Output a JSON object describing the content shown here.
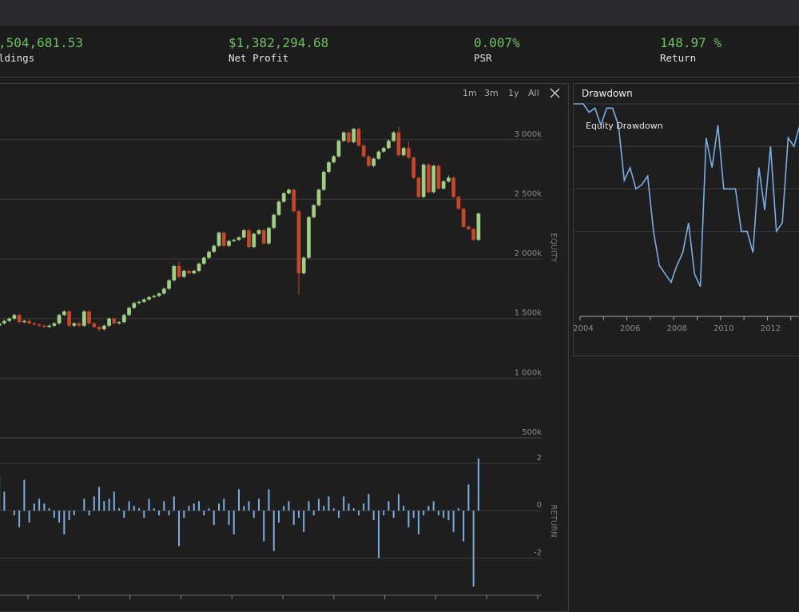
{
  "stats": [
    {
      "value": ",504,681.53",
      "label": "ldings"
    },
    {
      "value": "$1,382,294.68",
      "label": "Net Profit"
    },
    {
      "value": "0.007%",
      "label": "PSR"
    },
    {
      "value": "148.97 %",
      "label": "Return"
    }
  ],
  "range_buttons": [
    "1m",
    "3m",
    "1y",
    "All"
  ],
  "colors": {
    "up": "#9fcf80",
    "down": "#c8452a",
    "return_bar": "#7aaee0",
    "drawdown_line": "#7aaee0",
    "stat_value": "#6cc160"
  },
  "icons": {
    "close": "close-icon"
  },
  "equity_axis": {
    "label": "EQUITY",
    "ticks": [
      "500k",
      "1 000k",
      "1 500k",
      "2 000k",
      "2 500k",
      "3 000k"
    ]
  },
  "return_axis": {
    "label": "RETURN",
    "ticks": [
      "2",
      "0",
      "-2"
    ]
  },
  "drawdown": {
    "title": "Drawdown",
    "legend": "Equity Drawdown",
    "x_ticks": [
      "2004",
      "2006",
      "2008",
      "2010",
      "2012"
    ]
  },
  "chart_data": [
    {
      "type": "candlestick",
      "ylabel": "EQUITY",
      "ylim": [
        500000,
        3300000
      ],
      "candles": [
        [
          1440000,
          1460000,
          1420000,
          1470000
        ],
        [
          1460000,
          1480000,
          1450000,
          1490000
        ],
        [
          1480000,
          1500000,
          1470000,
          1510000
        ],
        [
          1500000,
          1530000,
          1490000,
          1540000
        ],
        [
          1530000,
          1470000,
          1460000,
          1540000
        ],
        [
          1470000,
          1480000,
          1460000,
          1490000
        ],
        [
          1480000,
          1460000,
          1450000,
          1490000
        ],
        [
          1460000,
          1450000,
          1440000,
          1470000
        ],
        [
          1450000,
          1440000,
          1430000,
          1460000
        ],
        [
          1440000,
          1430000,
          1420000,
          1450000
        ],
        [
          1430000,
          1440000,
          1420000,
          1450000
        ],
        [
          1440000,
          1460000,
          1430000,
          1470000
        ],
        [
          1460000,
          1530000,
          1450000,
          1540000
        ],
        [
          1530000,
          1560000,
          1520000,
          1570000
        ],
        [
          1560000,
          1440000,
          1430000,
          1570000
        ],
        [
          1440000,
          1460000,
          1430000,
          1470000
        ],
        [
          1460000,
          1440000,
          1430000,
          1470000
        ],
        [
          1440000,
          1560000,
          1430000,
          1570000
        ],
        [
          1560000,
          1460000,
          1450000,
          1570000
        ],
        [
          1460000,
          1430000,
          1420000,
          1470000
        ],
        [
          1430000,
          1410000,
          1390000,
          1440000
        ],
        [
          1410000,
          1440000,
          1400000,
          1450000
        ],
        [
          1440000,
          1500000,
          1430000,
          1510000
        ],
        [
          1500000,
          1460000,
          1450000,
          1510000
        ],
        [
          1460000,
          1470000,
          1450000,
          1480000
        ],
        [
          1470000,
          1530000,
          1460000,
          1540000
        ],
        [
          1530000,
          1590000,
          1520000,
          1600000
        ],
        [
          1590000,
          1630000,
          1580000,
          1640000
        ],
        [
          1630000,
          1640000,
          1620000,
          1650000
        ],
        [
          1640000,
          1660000,
          1630000,
          1670000
        ],
        [
          1660000,
          1680000,
          1650000,
          1690000
        ],
        [
          1680000,
          1690000,
          1670000,
          1700000
        ],
        [
          1690000,
          1710000,
          1680000,
          1720000
        ],
        [
          1710000,
          1750000,
          1700000,
          1760000
        ],
        [
          1750000,
          1820000,
          1740000,
          1830000
        ],
        [
          1820000,
          1940000,
          1810000,
          1950000
        ],
        [
          1940000,
          1850000,
          1840000,
          1980000
        ],
        [
          1850000,
          1900000,
          1840000,
          1910000
        ],
        [
          1900000,
          1880000,
          1870000,
          1910000
        ],
        [
          1880000,
          1900000,
          1870000,
          1910000
        ],
        [
          1900000,
          1960000,
          1890000,
          1970000
        ],
        [
          1960000,
          2010000,
          1950000,
          2020000
        ],
        [
          2010000,
          2060000,
          2000000,
          2070000
        ],
        [
          2060000,
          2110000,
          2050000,
          2120000
        ],
        [
          2110000,
          2220000,
          2100000,
          2230000
        ],
        [
          2220000,
          2110000,
          2100000,
          2230000
        ],
        [
          2110000,
          2150000,
          2100000,
          2160000
        ],
        [
          2150000,
          2160000,
          2140000,
          2170000
        ],
        [
          2160000,
          2180000,
          2150000,
          2190000
        ],
        [
          2180000,
          2240000,
          2170000,
          2250000
        ],
        [
          2240000,
          2100000,
          2090000,
          2250000
        ],
        [
          2100000,
          2210000,
          2090000,
          2220000
        ],
        [
          2210000,
          2240000,
          2200000,
          2250000
        ],
        [
          2240000,
          2130000,
          2120000,
          2250000
        ],
        [
          2130000,
          2260000,
          2120000,
          2270000
        ],
        [
          2260000,
          2370000,
          2250000,
          2380000
        ],
        [
          2370000,
          2480000,
          2360000,
          2490000
        ],
        [
          2480000,
          2550000,
          2470000,
          2560000
        ],
        [
          2550000,
          2580000,
          2540000,
          2590000
        ],
        [
          2580000,
          2400000,
          2390000,
          2590000
        ],
        [
          2400000,
          1880000,
          1700000,
          2410000
        ],
        [
          1880000,
          2010000,
          1870000,
          2020000
        ],
        [
          2010000,
          2350000,
          2000000,
          2360000
        ],
        [
          2350000,
          2450000,
          2340000,
          2460000
        ],
        [
          2450000,
          2580000,
          2440000,
          2590000
        ],
        [
          2580000,
          2730000,
          2570000,
          2740000
        ],
        [
          2730000,
          2810000,
          2720000,
          2820000
        ],
        [
          2810000,
          2860000,
          2800000,
          2870000
        ],
        [
          2860000,
          2990000,
          2850000,
          3000000
        ],
        [
          2990000,
          3060000,
          2980000,
          3070000
        ],
        [
          3060000,
          2980000,
          2970000,
          3070000
        ],
        [
          2980000,
          3090000,
          2970000,
          3100000
        ],
        [
          3090000,
          2950000,
          2940000,
          3100000
        ],
        [
          2950000,
          2860000,
          2850000,
          2960000
        ],
        [
          2860000,
          2780000,
          2770000,
          2870000
        ],
        [
          2780000,
          2840000,
          2770000,
          2850000
        ],
        [
          2840000,
          2900000,
          2830000,
          2910000
        ],
        [
          2900000,
          2930000,
          2890000,
          2940000
        ],
        [
          2930000,
          2990000,
          2920000,
          3000000
        ],
        [
          2990000,
          3060000,
          2980000,
          3070000
        ],
        [
          3060000,
          2870000,
          2860000,
          3110000
        ],
        [
          2870000,
          2930000,
          2860000,
          2940000
        ],
        [
          2930000,
          2850000,
          2840000,
          2980000
        ],
        [
          2850000,
          2680000,
          2670000,
          2860000
        ],
        [
          2680000,
          2520000,
          2510000,
          2690000
        ],
        [
          2520000,
          2790000,
          2510000,
          2800000
        ],
        [
          2790000,
          2560000,
          2550000,
          2800000
        ],
        [
          2560000,
          2780000,
          2550000,
          2790000
        ],
        [
          2780000,
          2590000,
          2580000,
          2790000
        ],
        [
          2590000,
          2650000,
          2580000,
          2660000
        ],
        [
          2650000,
          2680000,
          2640000,
          2700000
        ],
        [
          2680000,
          2520000,
          2510000,
          2690000
        ],
        [
          2520000,
          2420000,
          2410000,
          2530000
        ],
        [
          2420000,
          2270000,
          2260000,
          2430000
        ],
        [
          2270000,
          2250000,
          2240000,
          2280000
        ],
        [
          2250000,
          2160000,
          2150000,
          2260000
        ],
        [
          2160000,
          2380000,
          2150000,
          2390000
        ]
      ]
    },
    {
      "type": "bar",
      "ylabel": "RETURN",
      "ylim": [
        -3.4,
        2.6
      ],
      "values": [
        1.5,
        0.8,
        0,
        -0.2,
        -0.7,
        1.3,
        -0.5,
        0.3,
        0.5,
        0.3,
        0.1,
        -0.3,
        -0.5,
        -1.0,
        -0.4,
        -0.2,
        0,
        0.5,
        -0.2,
        0.6,
        1.0,
        0.4,
        0.5,
        0.8,
        0.1,
        -0.3,
        0.4,
        0.2,
        0.1,
        -0.3,
        0.5,
        0.1,
        -0.2,
        0.4,
        -0.2,
        0.6,
        -1.5,
        -0.3,
        0.2,
        0.3,
        0.4,
        -0.2,
        0.1,
        -0.6,
        0.3,
        0.5,
        -0.6,
        -1.0,
        0.9,
        0.2,
        0.4,
        -0.3,
        0.5,
        -1.3,
        0.9,
        -1.7,
        -0.5,
        0.2,
        0.4,
        -0.6,
        -0.3,
        -0.9,
        0.4,
        -0.2,
        0.5,
        0.2,
        0.6,
        0.1,
        -0.3,
        0.6,
        0.3,
        0.1,
        -0.2,
        0.3,
        0.7,
        -0.4,
        -2.0,
        -0.2,
        0.4,
        -0.3,
        0.7,
        0.2,
        -0.7,
        -0.3,
        -1.0,
        -0.2,
        0.2,
        0.4,
        -0.2,
        -0.3,
        -0.4,
        -0.9,
        0.1,
        -1.3,
        1.1,
        -3.2,
        2.2
      ]
    },
    {
      "type": "line",
      "title": "Drawdown",
      "series": [
        {
          "name": "Equity Drawdown"
        }
      ],
      "x": [
        2003.5,
        2003.75,
        2004,
        2004.25,
        2004.5,
        2004.75,
        2005,
        2005.25,
        2005.5,
        2005.75,
        2006,
        2006.25,
        2006.5,
        2006.75,
        2007,
        2007.25,
        2007.5,
        2007.75,
        2008,
        2008.25,
        2008.5,
        2008.75,
        2009,
        2009.25,
        2009.5,
        2009.75,
        2010,
        2010.25,
        2010.5,
        2010.75,
        2011,
        2011.25,
        2011.5,
        2011.75,
        2012,
        2012.25,
        2012.5,
        2012.75,
        2013,
        2013.25,
        2013.5
      ],
      "y": [
        0,
        0,
        0,
        -2,
        -1,
        -5,
        -1,
        -1,
        -5,
        -18,
        -15,
        -20,
        -19,
        -17,
        -30,
        -38,
        -40,
        -42,
        -38,
        -35,
        -28,
        -40,
        -43,
        -8,
        -15,
        -5,
        -20,
        -20,
        -20,
        -30,
        -30,
        -35,
        -15,
        -25,
        -10,
        -30,
        -28,
        -8,
        -10,
        -5,
        -20
      ],
      "xlim": [
        2003.5,
        2013.5
      ],
      "ylim": [
        -50,
        0
      ],
      "x_ticks": [
        "2004",
        "2006",
        "2008",
        "2010",
        "2012"
      ]
    }
  ]
}
